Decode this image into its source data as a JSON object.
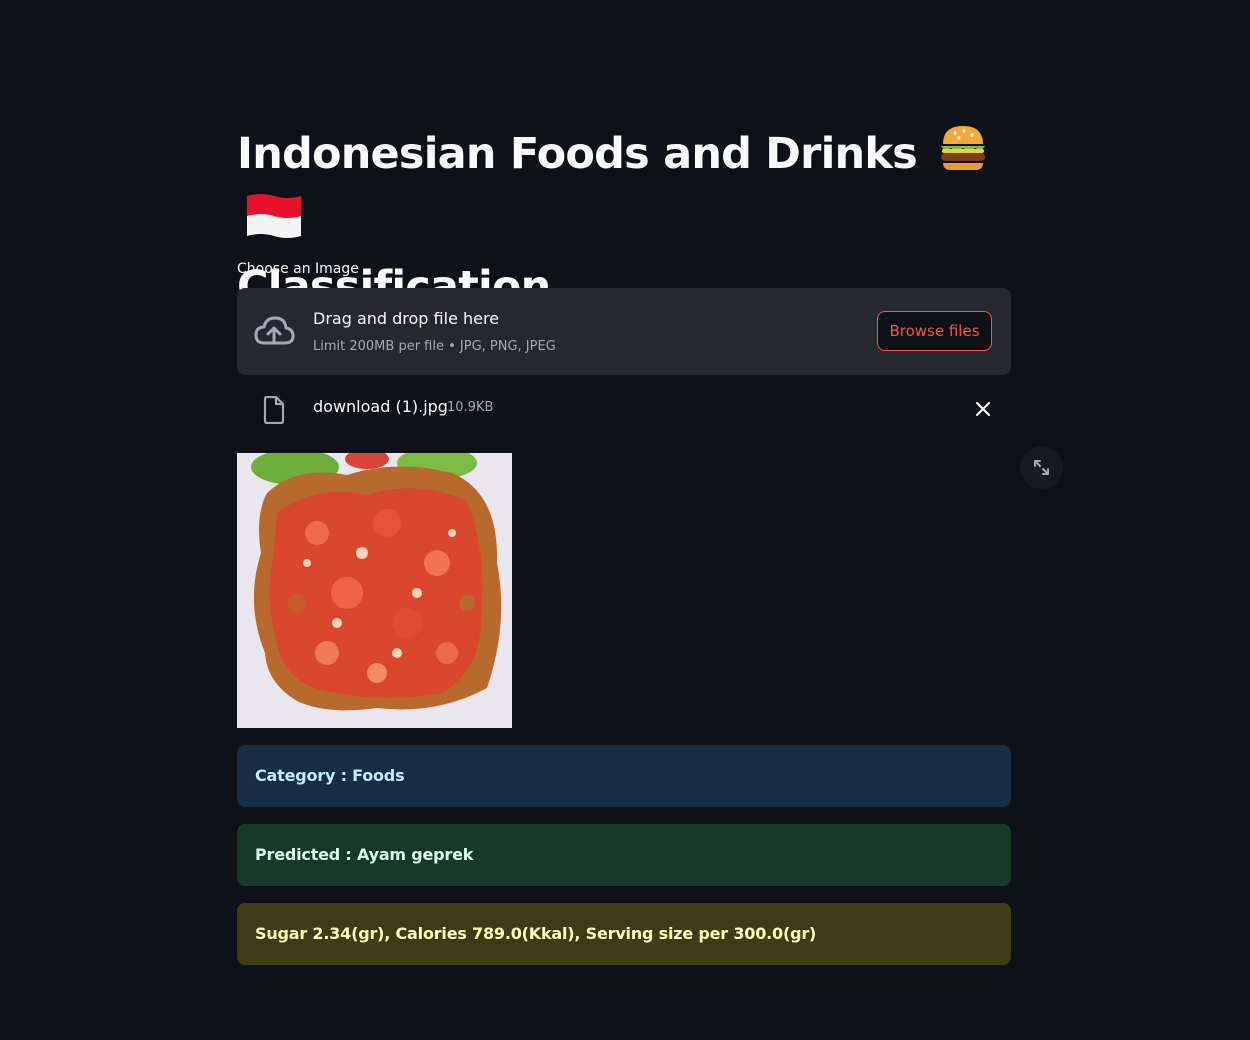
{
  "page": {
    "title_line1": "Indonesian Foods and Drinks",
    "title_line2": "Classification",
    "title_emojis": [
      "burger-icon",
      "indonesia-flag-icon"
    ]
  },
  "uploader": {
    "label": "Choose an Image",
    "drop_title": "Drag and drop file here",
    "drop_subtitle": "Limit 200MB per file • JPG, PNG, JPEG",
    "browse_label": "Browse files",
    "icon": "cloud-upload-icon"
  },
  "uploaded_file": {
    "name": "download (1).jpg",
    "size": "10.9KB",
    "icon": "file-icon",
    "remove_icon": "close-icon"
  },
  "image": {
    "alt": "Ayam geprek photo"
  },
  "results": {
    "category": "Category : Foods",
    "predicted": "Predicted : Ayam geprek",
    "nutrition": "Sugar 2.34(gr), Calories 789.0(Kkal), Serving size per 300.0(gr)"
  },
  "colors": {
    "background": "#0e1117",
    "accent": "#ff4b4b",
    "info_bg": "#172d43",
    "success_bg": "#173928",
    "warning_bg": "#3e3b16"
  }
}
